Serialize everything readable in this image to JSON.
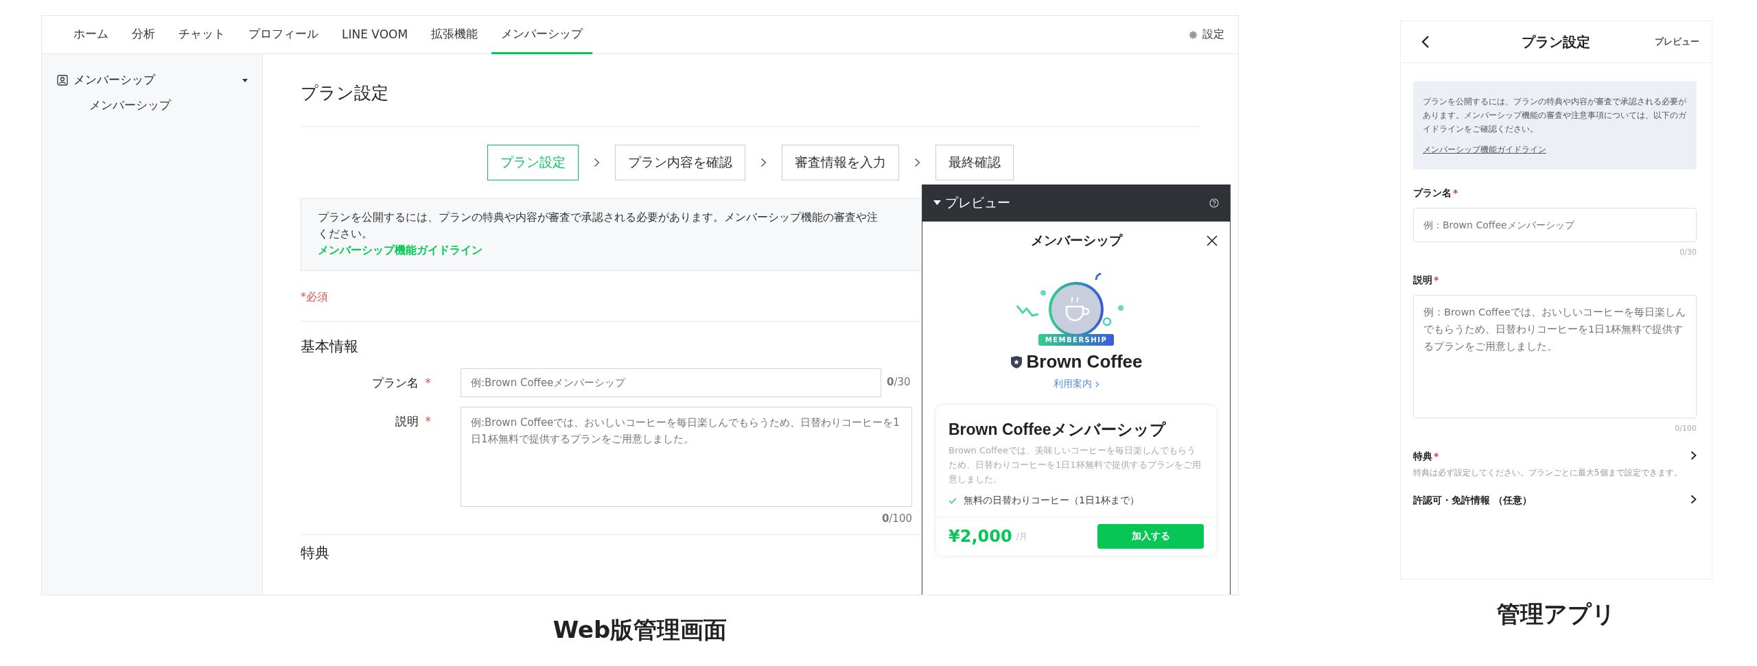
{
  "web_admin": {
    "caption": "Web版管理画面",
    "nav": {
      "tabs": [
        {
          "label": "ホーム",
          "selected": false
        },
        {
          "label": "分析",
          "selected": false
        },
        {
          "label": "チャット",
          "selected": false
        },
        {
          "label": "プロフィール",
          "selected": false
        },
        {
          "label": "LINE VOOM",
          "selected": false
        },
        {
          "label": "拡張機能",
          "selected": false
        },
        {
          "label": "メンバーシップ",
          "selected": true
        }
      ],
      "settings": "設定"
    },
    "sidebar": {
      "section": "メンバーシップ",
      "expanded": true,
      "items": [
        "メンバーシップ"
      ]
    },
    "page_title": "プラン設定",
    "steps": [
      {
        "label": "プラン設定",
        "selected": true
      },
      {
        "label": "プラン内容を確認",
        "selected": false
      },
      {
        "label": "審査情報を入力",
        "selected": false
      },
      {
        "label": "最終確認",
        "selected": false
      }
    ],
    "notice": {
      "lines": [
        "プランを公開するには、プランの特典や内容が審査で承認される必要があります。メンバーシップ機能の審査や注",
        "ください。"
      ],
      "link": "メンバーシップ機能ガイドライン"
    },
    "required_note": "*必須",
    "section_title": "基本情報",
    "fields": [
      {
        "kind": "input",
        "label": "プラン名",
        "mark": "*",
        "placeholder": "例:Brown Coffeeメンバーシップ",
        "count": "0",
        "limit": "/30"
      },
      {
        "kind": "textarea",
        "label": "説明",
        "mark": "*",
        "placeholder": "例:Brown Coffeeでは、おいしいコーヒーを毎日楽しんでもらうため、日替わりコーヒーを1日1杯無料で提供するプランをご用意しました。",
        "count": "0",
        "limit": "/100"
      }
    ],
    "next_section": "特典",
    "preview": {
      "title": "プレビュー",
      "modal_title": "メンバーシップ",
      "badge_text": "MEMBERSHIP",
      "brand": "Brown Coffee",
      "guide_link": "利用案内",
      "plan": {
        "name": "Brown Coffeeメンバーシップ",
        "description": "Brown Coffeeでは、美味しいコーヒーを毎日楽しんでもらうため、日替わりコーヒーを1日1杯無料で提供するプランをご用意しました。",
        "benefits": [
          "無料の日替わりコーヒー（1日1杯まで）"
        ],
        "price": "¥2,000",
        "period": "/月",
        "join_button": "加入する"
      }
    }
  },
  "mobile_app": {
    "caption": "管理アプリ",
    "header": {
      "title": "プラン設定",
      "action": "プレビュー"
    },
    "notice": {
      "text": "プランを公開するには、プランの特典や内容が審査で承認される必要があります。メンバーシップ機能の審査や注意事項については、以下のガイドラインをご確認ください。",
      "link": "メンバーシップ機能ガイドライン"
    },
    "fields": [
      {
        "kind": "input",
        "label": "プラン名",
        "mark": "*",
        "placeholder": "例：Brown Coffeeメンバーシップ",
        "counter": "0/30"
      },
      {
        "kind": "textarea",
        "label": "説明",
        "mark": "*",
        "placeholder": "例：Brown Coffeeでは、おいしいコーヒーを毎日楽しんでもらうため、日替わりコーヒーを1日1杯無料で提供するプランをご用意しました。",
        "counter": "0/100"
      }
    ],
    "links": [
      {
        "label": "特典",
        "mark": "*",
        "hint": "特典は必ず設定してください。プランごとに最大5個まで設定できます。"
      },
      {
        "label": "許認可・免許情報 （任意）"
      }
    ]
  }
}
